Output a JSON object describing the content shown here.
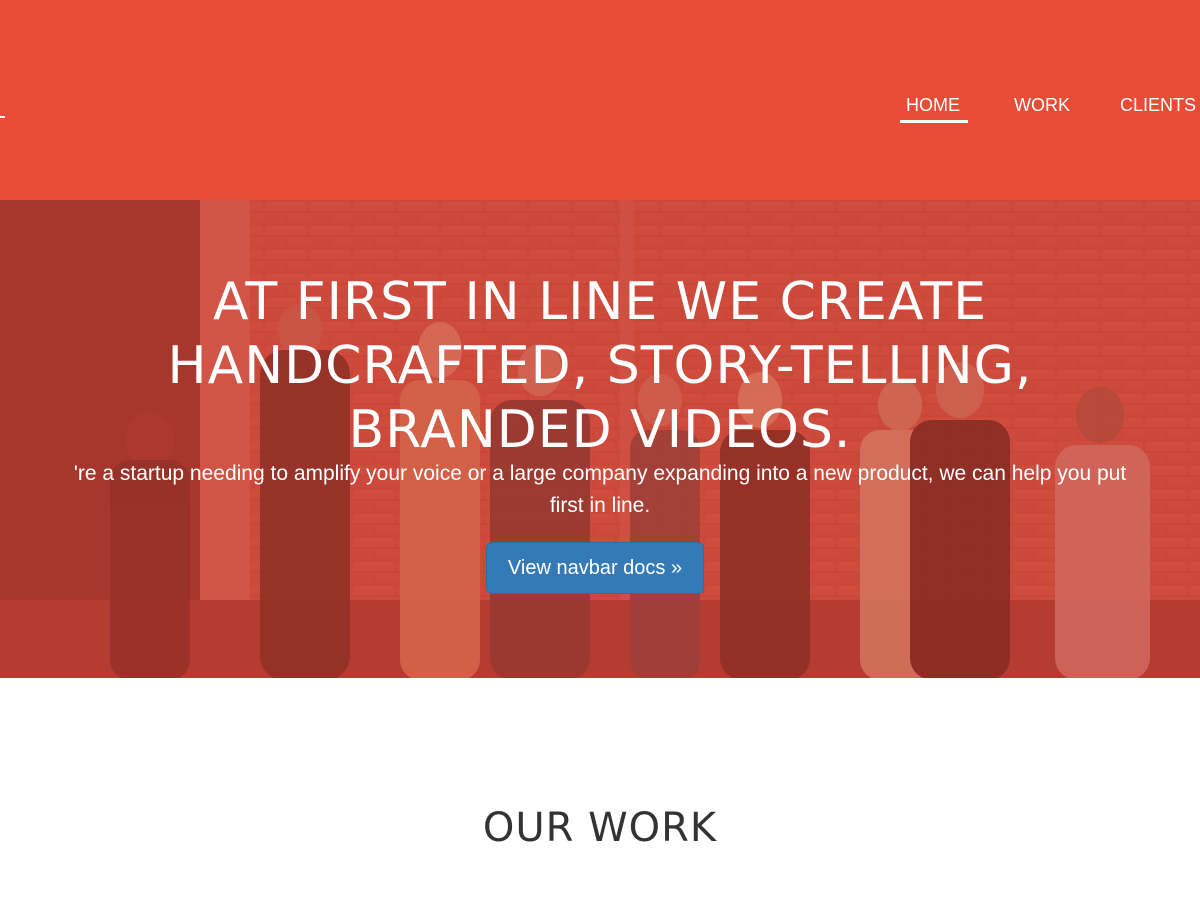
{
  "colors": {
    "navbar_bg": "#e84c36",
    "hero_overlay": "#d74637",
    "button_bg": "#337ab7",
    "section_title": "#333333"
  },
  "nav": {
    "items": [
      {
        "label": "HOME",
        "active": true
      },
      {
        "label": "WORK",
        "active": false
      },
      {
        "label": "CLIENTS",
        "active": false
      }
    ]
  },
  "hero": {
    "title_lines": [
      "AT FIRST IN LINE WE CREATE",
      "HANDCRAFTED, STORY-TELLING,",
      "BRANDED VIDEOS."
    ],
    "subtitle_lines": [
      "'re a startup needing to amplify your voice or a large company expanding into a new product, we can help you put",
      "first in line."
    ],
    "button_label": "View navbar docs »"
  },
  "section": {
    "title": "OUR WORK"
  }
}
